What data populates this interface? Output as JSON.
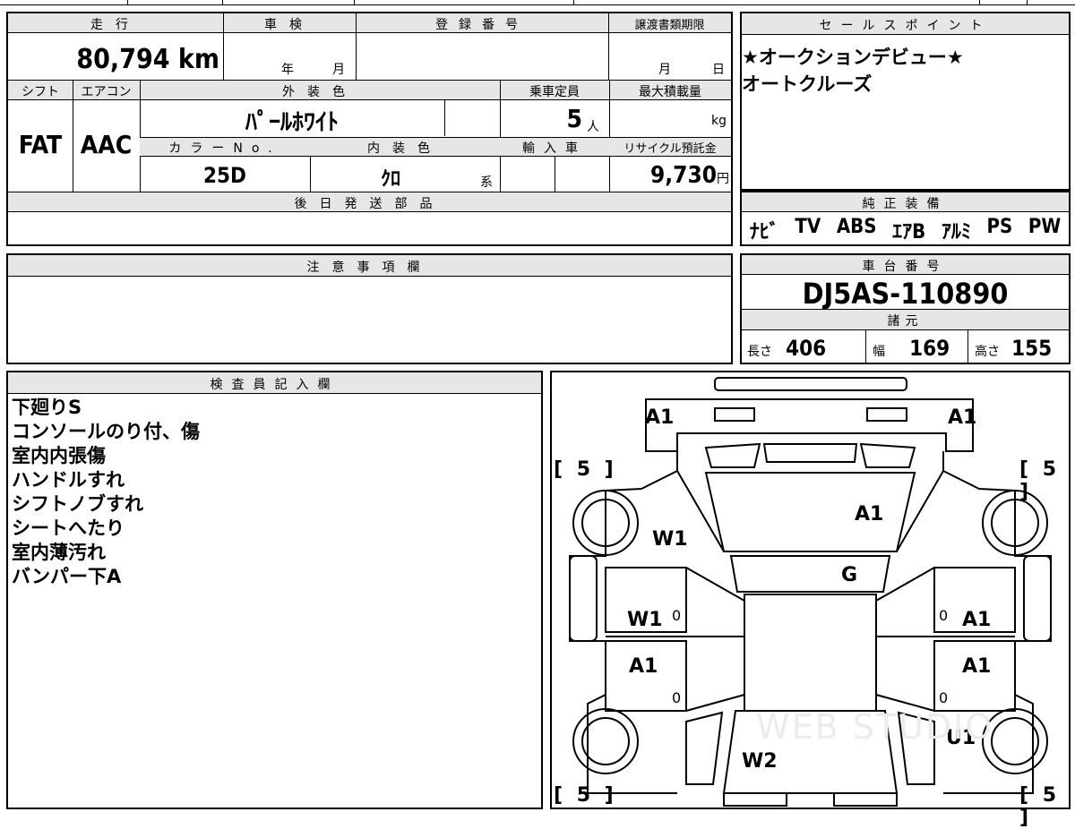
{
  "sheet": {
    "mileage": {
      "label": "走行",
      "value": "80,794",
      "unit": "km"
    },
    "shaken": {
      "label": "車検",
      "year_unit": "年",
      "month_unit": "月"
    },
    "registration": {
      "label": "登録番号"
    },
    "transfer_deadline": {
      "label": "譲渡書類期限",
      "month_unit": "月",
      "day_unit": "日"
    },
    "shift": {
      "label": "シフト",
      "value": "FAT"
    },
    "aircon": {
      "label": "エアコン",
      "value": "AAC"
    },
    "exterior_color": {
      "label": "外装色",
      "value": "ﾊﾟｰﾙﾎﾜｲﾄ"
    },
    "capacity": {
      "label": "乗車定員",
      "value": "5",
      "unit": "人"
    },
    "max_load": {
      "label": "最大積載量",
      "unit": "kg"
    },
    "color_no": {
      "label": "カラーNo.",
      "value": "25D"
    },
    "interior_color": {
      "label": "内装色",
      "value": "ｸﾛ",
      "suffix": "系"
    },
    "import": {
      "label": "輸入車"
    },
    "recycle_fee": {
      "label": "リサイクル預託金",
      "value": "9,730",
      "unit": "円"
    },
    "later_parts": {
      "label": "後日発送部品"
    },
    "notes": {
      "label": "注意事項欄"
    }
  },
  "sales_points": {
    "label": "セールスポイント",
    "lines": [
      "★オークションデビュー★",
      "オートクルーズ"
    ]
  },
  "equipment": {
    "label": "純正装備",
    "items": [
      "ﾅﾋﾞ",
      "TV",
      "ABS",
      "ｴｱB",
      "ｱﾙﾐ",
      "PS",
      "PW"
    ]
  },
  "chassis": {
    "label": "車台番号",
    "value": "DJ5AS-110890"
  },
  "specs": {
    "label": "諸元",
    "length_label": "長さ",
    "length": "406",
    "width_label": "幅",
    "width": "169",
    "height_label": "高さ",
    "height": "155"
  },
  "inspector": {
    "label": "検査員記入欄",
    "lines": [
      "下廻りS",
      "コンソールのり付、傷",
      "室内内張傷",
      "ハンドルすれ",
      "シフトノブすれ",
      "シートへたり",
      "室内薄汚れ",
      "バンパー下A"
    ]
  },
  "diagram": {
    "marks": [
      "A1",
      "A1",
      "A1",
      "W1",
      "G",
      "W1",
      "A1",
      "A1",
      "A1",
      "U1",
      "W2",
      "0",
      "0",
      "0",
      "0"
    ],
    "tires": [
      "[ 5 ]",
      "[ 5 ]",
      "[ 5 ]",
      "[ 5 ]"
    ],
    "watermark": "WEB STUDIO"
  }
}
